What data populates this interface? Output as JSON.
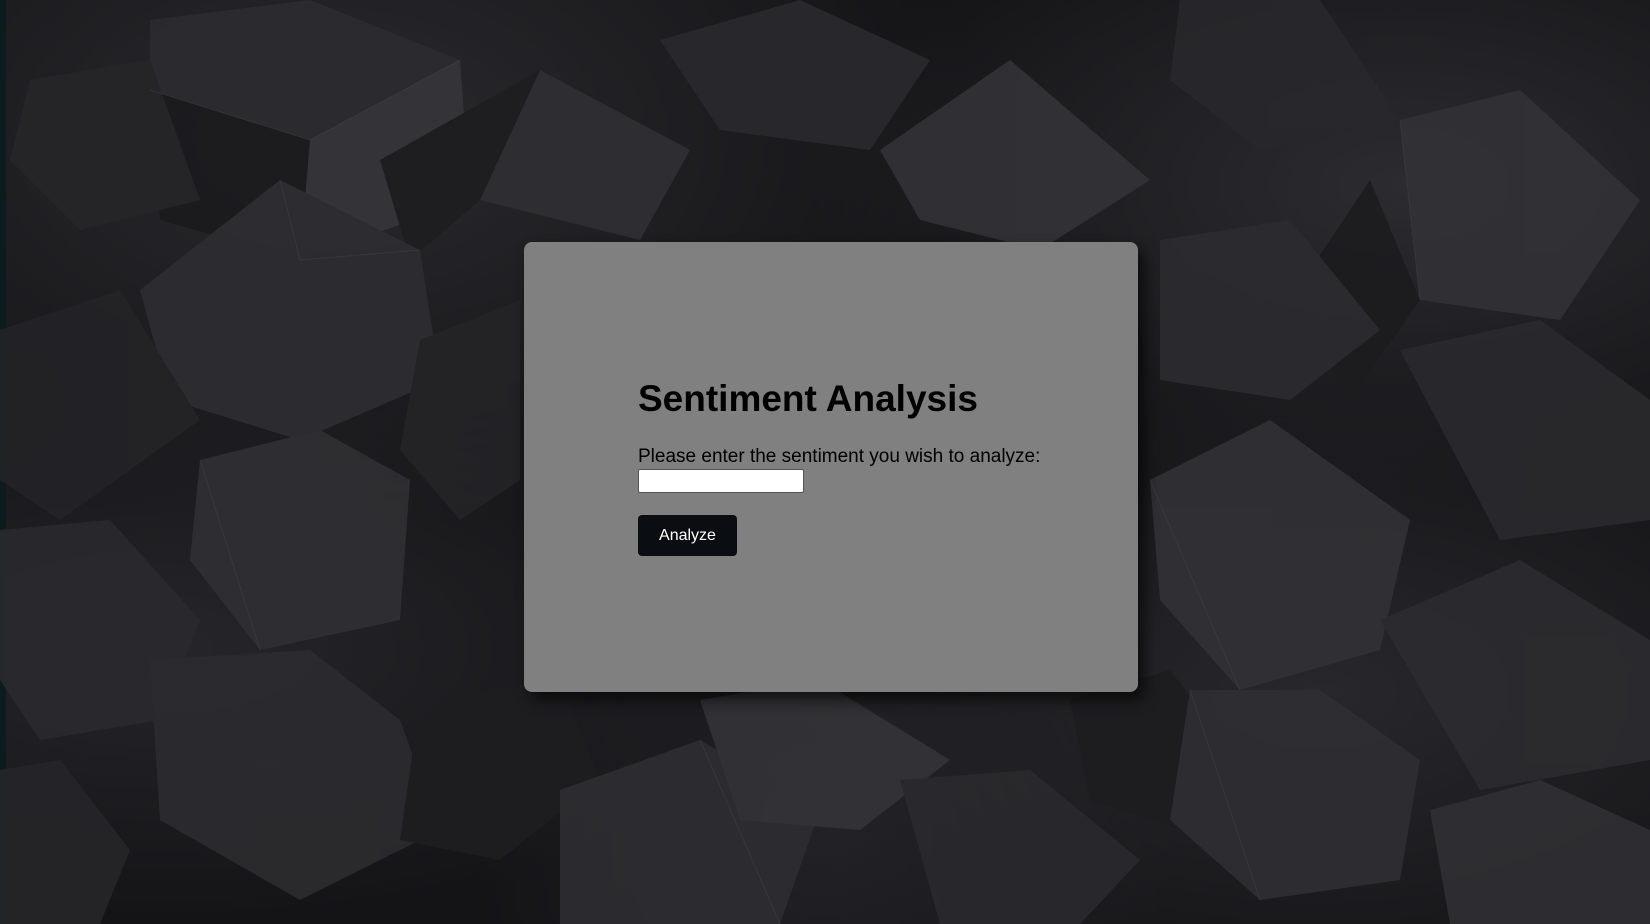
{
  "form": {
    "title": "Sentiment Analysis",
    "prompt": "Please enter the sentiment you wish to analyze:",
    "input_value": "",
    "button_label": "Analyze"
  },
  "colors": {
    "panel": "#808080",
    "button": "#0a0e12",
    "button_text": "#ffffff",
    "background": "#141417"
  }
}
